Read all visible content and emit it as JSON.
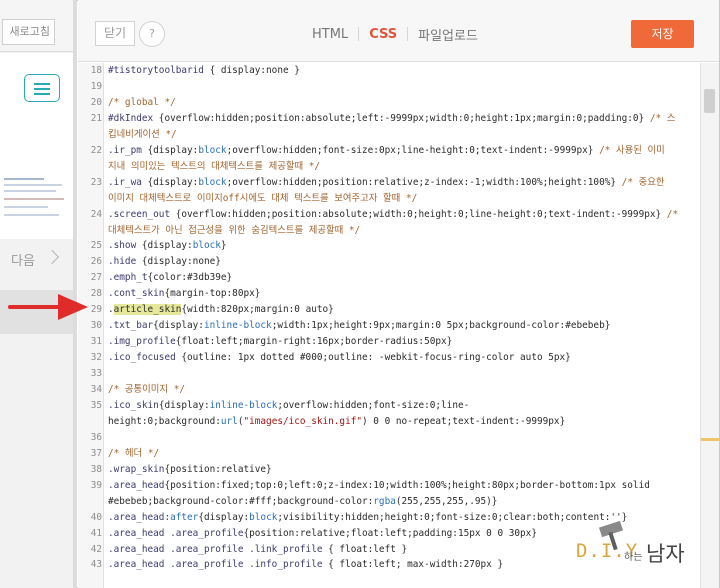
{
  "left_panel": {
    "reload_label": "새로고침",
    "next_label": "다음"
  },
  "toolbar": {
    "close_label": "닫기",
    "help_label": "?",
    "tabs": [
      {
        "label": "HTML",
        "active": false
      },
      {
        "label": "CSS",
        "active": true
      },
      {
        "label": "파일업로드",
        "active": false
      }
    ],
    "save_label": "저장"
  },
  "editor": {
    "lines": [
      {
        "n": "18",
        "segs": [
          [
            "sel",
            "#tistorytoolbarid"
          ],
          [
            "",
            " { display:none }"
          ]
        ]
      },
      {
        "n": "19",
        "segs": []
      },
      {
        "n": "20",
        "segs": [
          [
            "comment",
            "/* global */"
          ]
        ]
      },
      {
        "n": "21",
        "segs": [
          [
            "sel",
            "#dkIndex"
          ],
          [
            "",
            " {overflow:hidden;position:absolute;left:-9999px;width:0;height:1px;margin:0;padding:0} "
          ],
          [
            "comment",
            "/* 스"
          ]
        ]
      },
      {
        "n": "",
        "segs": [
          [
            "comment",
            "킵네비게이션 */"
          ]
        ]
      },
      {
        "n": "22",
        "segs": [
          [
            "sel",
            ".ir_pm"
          ],
          [
            "",
            " {display:"
          ],
          [
            "kw",
            "block"
          ],
          [
            "",
            ";overflow:hidden;font-size:0px;line-height:0;text-indent:-9999px} "
          ],
          [
            "comment",
            "/* 사용된 이미"
          ]
        ]
      },
      {
        "n": "",
        "segs": [
          [
            "comment",
            "지내 의미있는 텍스트의 대체텍스트를 제공할때 */"
          ]
        ]
      },
      {
        "n": "23",
        "segs": [
          [
            "sel",
            ".ir_wa"
          ],
          [
            "",
            " {display:"
          ],
          [
            "kw",
            "block"
          ],
          [
            "",
            ";overflow:hidden;position:relative;z-index:-1;width:100%;height:100%} "
          ],
          [
            "comment",
            "/* 중요한"
          ]
        ]
      },
      {
        "n": "",
        "segs": [
          [
            "comment",
            "이미지 대체텍스트로 이미지off시에도 대체 텍스트를 보여주고자 할때 */"
          ]
        ]
      },
      {
        "n": "24",
        "segs": [
          [
            "sel",
            ".screen_out"
          ],
          [
            "",
            " {overflow:hidden;position:absolute;width:0;height:0;line-height:0;text-indent:-9999px} "
          ],
          [
            "comment",
            "/*"
          ]
        ]
      },
      {
        "n": "",
        "segs": [
          [
            "comment",
            "대체텍스트가 아닌 접근성을 위한 숨김텍스트를 제공할때 */"
          ]
        ]
      },
      {
        "n": "25",
        "segs": [
          [
            "sel",
            ".show"
          ],
          [
            "",
            " {display:"
          ],
          [
            "kw",
            "block"
          ],
          [
            "",
            "}"
          ]
        ]
      },
      {
        "n": "26",
        "segs": [
          [
            "sel",
            ".hide"
          ],
          [
            "",
            " {display:none}"
          ]
        ]
      },
      {
        "n": "27",
        "segs": [
          [
            "sel",
            ".emph_t"
          ],
          [
            "",
            "{color:#3db39e}"
          ]
        ]
      },
      {
        "n": "28",
        "segs": [
          [
            "sel",
            ".cont_skin"
          ],
          [
            "",
            "{margin-top:80px}"
          ]
        ]
      },
      {
        "n": "29",
        "segs": [
          [
            "",
            "."
          ],
          [
            "hl",
            "article_skin"
          ],
          [
            "",
            "{width:820px;margin:0 auto}"
          ]
        ]
      },
      {
        "n": "30",
        "segs": [
          [
            "sel",
            ".txt_bar"
          ],
          [
            "",
            "{display:"
          ],
          [
            "kw",
            "inline-block"
          ],
          [
            "",
            ";width:1px;height:9px;margin:0 5px;background-color:#ebebeb}"
          ]
        ]
      },
      {
        "n": "31",
        "segs": [
          [
            "sel",
            ".img_profile"
          ],
          [
            "",
            "{float:left;margin-right:16px;border-radius:50px}"
          ]
        ]
      },
      {
        "n": "32",
        "segs": [
          [
            "sel",
            ".ico_focused"
          ],
          [
            "",
            " {outline: 1px dotted #000;outline: -webkit-focus-ring-color auto 5px}"
          ]
        ]
      },
      {
        "n": "33",
        "segs": []
      },
      {
        "n": "34",
        "segs": [
          [
            "comment",
            "/* 공통이미지 */"
          ]
        ]
      },
      {
        "n": "35",
        "segs": [
          [
            "sel",
            ".ico_skin"
          ],
          [
            "",
            "{display:"
          ],
          [
            "kw",
            "inline-block"
          ],
          [
            "",
            ";overflow:hidden;font-size:0;line-"
          ]
        ]
      },
      {
        "n": "",
        "segs": [
          [
            "",
            "height:0;background:"
          ],
          [
            "kw",
            "url"
          ],
          [
            "",
            "("
          ],
          [
            "str",
            "\"images/ico_skin.gif\""
          ],
          [
            "",
            ") 0 0 no-repeat;text-indent:-9999px}"
          ]
        ]
      },
      {
        "n": "36",
        "segs": []
      },
      {
        "n": "37",
        "segs": [
          [
            "comment",
            "/* 헤더 */"
          ]
        ]
      },
      {
        "n": "38",
        "segs": [
          [
            "sel",
            ".wrap_skin"
          ],
          [
            "",
            "{position:relative}"
          ]
        ]
      },
      {
        "n": "39",
        "segs": [
          [
            "sel",
            ".area_head"
          ],
          [
            "",
            "{position:fixed;top:0;left:0;z-index:10;width:100%;height:80px;border-bottom:1px solid"
          ]
        ]
      },
      {
        "n": "",
        "segs": [
          [
            "",
            "#ebebeb;background-color:#fff;background-color:"
          ],
          [
            "kw",
            "rgba"
          ],
          [
            "",
            "(255,255,255,.95)}"
          ]
        ]
      },
      {
        "n": "40",
        "segs": [
          [
            "sel",
            ".area_head:"
          ],
          [
            "kw",
            "after"
          ],
          [
            "",
            "{display:"
          ],
          [
            "kw",
            "block"
          ],
          [
            "",
            ";visibility:hidden;height:0;font-size:0;clear:both;content:''}"
          ]
        ]
      },
      {
        "n": "41",
        "segs": [
          [
            "sel",
            ".area_head .area_profile"
          ],
          [
            "",
            "{position:relative;float:left;padding:15px 0 0 30px}"
          ]
        ]
      },
      {
        "n": "42",
        "segs": [
          [
            "sel",
            ".area_head .area_profile .link_profile"
          ],
          [
            "",
            " { float:left }"
          ]
        ]
      },
      {
        "n": "43",
        "segs": [
          [
            "sel",
            ".area_head .area_profile .info_profile"
          ],
          [
            "",
            " { float:left; max-width:270px }"
          ]
        ]
      }
    ]
  },
  "watermark": {
    "brand": "D.I.Y",
    "middle": "하는",
    "suffix": "남자",
    "icon": "hammer-icon"
  },
  "colors": {
    "accent": "#ef6a38",
    "active_tab": "#e2553a",
    "comment": "#a0642f",
    "keyword": "#2a6fb8",
    "highlight": "#e5e79a",
    "menu_teal": "#2aa9b5",
    "arrow": "#e02b2b"
  }
}
